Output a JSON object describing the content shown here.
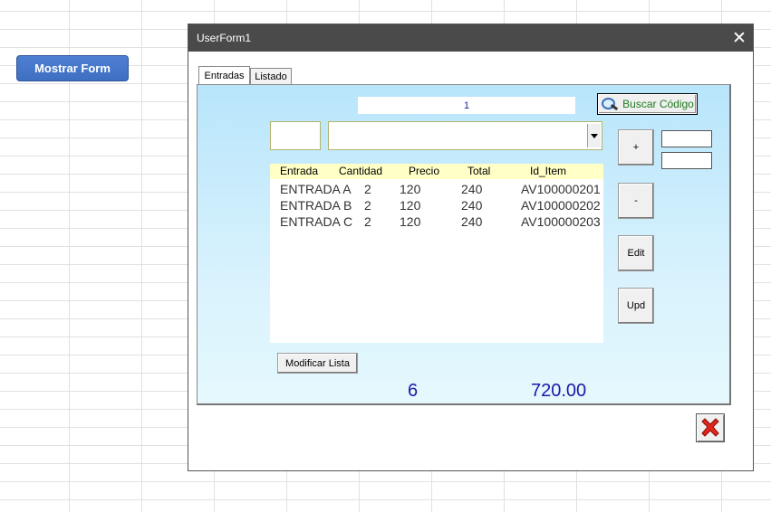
{
  "sheet": {
    "button_label": "Mostrar Form"
  },
  "window": {
    "title": "UserForm1",
    "close_glyph": "✕",
    "tabs": [
      {
        "label": "Entradas",
        "active": true
      },
      {
        "label": "Listado",
        "active": false
      }
    ],
    "code_display": "1",
    "buscar_label": "Buscar Código",
    "list": {
      "headers": [
        "Entrada",
        "Cantidad",
        "Precio",
        "Total",
        "Id_Item"
      ],
      "rows": [
        [
          "ENTRADA A",
          "2",
          "120",
          "240",
          "AV100000201"
        ],
        [
          "ENTRADA B",
          "2",
          "120",
          "240",
          "AV100000202"
        ],
        [
          "ENTRADA C",
          "2",
          "120",
          "240",
          "AV100000203"
        ]
      ]
    },
    "side_buttons": {
      "add": "+",
      "remove": "-",
      "edit": "Edit",
      "update": "Upd"
    },
    "modificar_label": "Modificar Lista",
    "total_count": "6",
    "total_amount": "720.00",
    "icons": {
      "search": "magnifier-icon",
      "exit": "red-x-icon"
    },
    "colors": {
      "accent_blue": "#1a1aa8",
      "header_yellow": "#ffffc6",
      "exit_red": "#e0261b"
    }
  }
}
